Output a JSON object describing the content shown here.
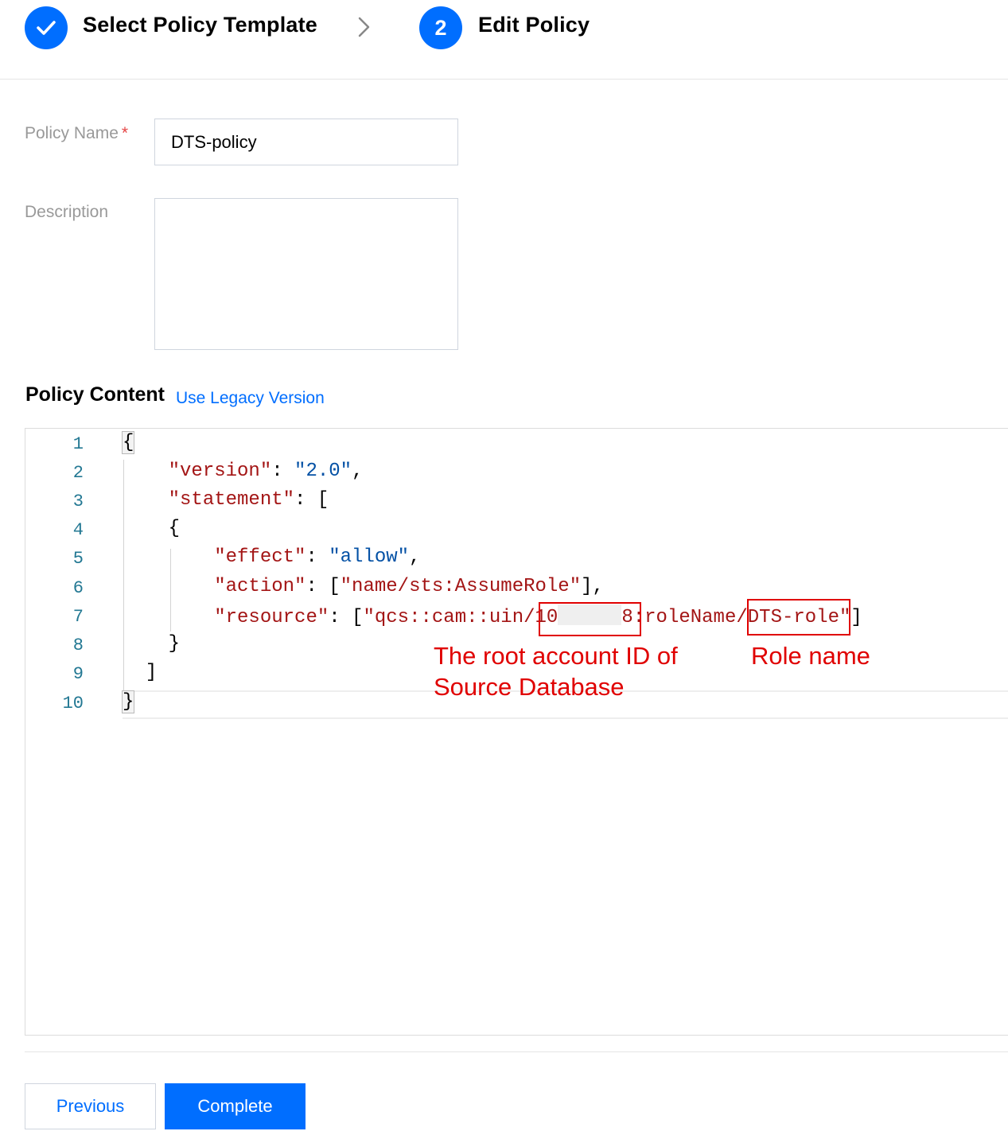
{
  "stepper": {
    "step1": {
      "label": "Select Policy Template",
      "status": "completed"
    },
    "step2": {
      "number": "2",
      "label": "Edit Policy",
      "status": "current"
    }
  },
  "form": {
    "policy_name": {
      "label": "Policy Name",
      "required_mark": "*",
      "value": "DTS-policy"
    },
    "description": {
      "label": "Description",
      "value": ""
    }
  },
  "policy_content": {
    "title": "Policy Content",
    "legacy_link": "Use Legacy Version",
    "line_numbers": [
      "1",
      "2",
      "3",
      "4",
      "5",
      "6",
      "7",
      "8",
      "9",
      "10"
    ],
    "code": {
      "l1": "{",
      "l2_key": "\"version\"",
      "l2_sep": ": ",
      "l2_val": "\"2.0\"",
      "l2_end": ",",
      "l3_key": "\"statement\"",
      "l3_rest": ": [",
      "l4": "{",
      "l5_key": "\"effect\"",
      "l5_sep": ": ",
      "l5_val": "\"allow\"",
      "l5_end": ",",
      "l6_key": "\"action\"",
      "l6_sep": ": [",
      "l6_val": "\"name/sts:AssumeRole\"",
      "l6_end": "],",
      "l7_key": "\"resource\"",
      "l7_sep": ": [",
      "l7_val_a": "\"qcs::cam::uin/",
      "l7_id_start": "10",
      "l7_id_end": "8",
      "l7_val_b": ":roleName/",
      "l7_role": "DTS-role",
      "l7_val_c": "\"",
      "l7_end": "]",
      "l8": "}",
      "l9": "]",
      "l10": "}"
    }
  },
  "annotations": {
    "root_account_line1": "The root account ID of",
    "root_account_line2": "Source Database",
    "role_name": "Role name",
    "color": "#e00000"
  },
  "footer": {
    "previous_label": "Previous",
    "complete_label": "Complete"
  },
  "colors": {
    "accent": "#006eff",
    "json_key": "#a31515",
    "json_value": "#0451a5",
    "line_number": "#237893"
  }
}
